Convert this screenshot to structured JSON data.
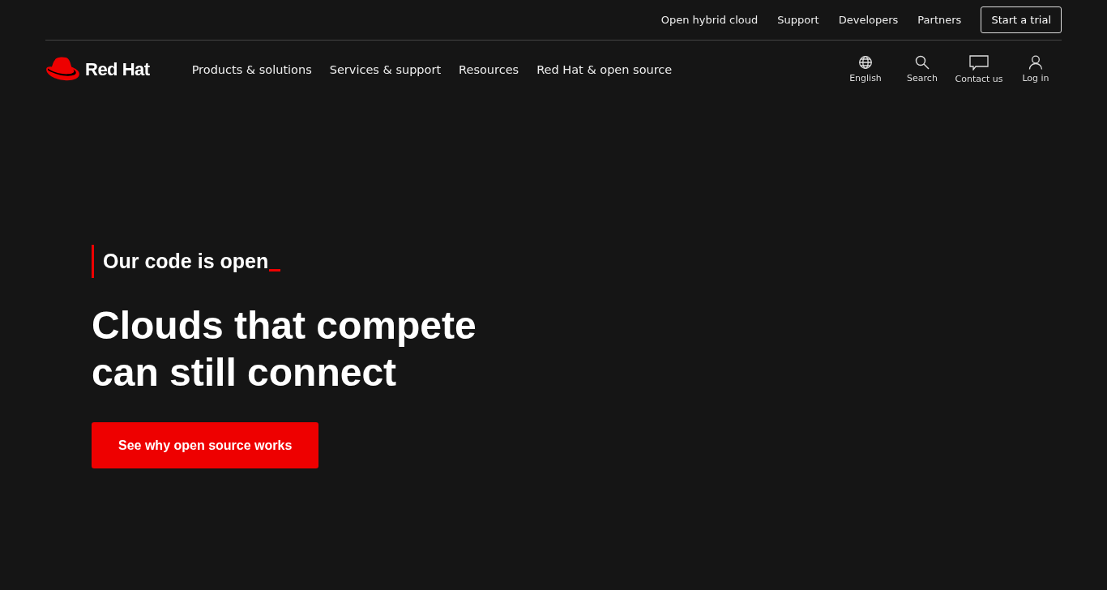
{
  "top_links": [
    "Open hybrid cloud",
    "Support",
    "Developers",
    "Partners"
  ],
  "trial_button": "Start a trial",
  "logo": "Red Hat",
  "main_nav": [
    "Products & solutions",
    "Services & support",
    "Resources",
    "Red Hat & open source"
  ],
  "utility": [
    {
      "kind": "globe",
      "label": "English"
    },
    {
      "kind": "search",
      "label": "Search"
    },
    {
      "kind": "chat",
      "label": "Contact us"
    },
    {
      "kind": "user",
      "label": "Log in"
    }
  ],
  "hero": {
    "eyebrow": "Our code is open",
    "title": "Clouds that compete can still connect",
    "button": "See why open source works"
  }
}
